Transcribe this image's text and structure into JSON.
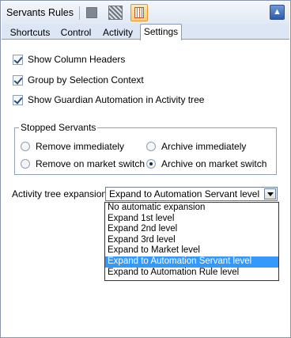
{
  "toolbar": {
    "servants": "Servants",
    "rules": "Rules",
    "icons": [
      "stop-icon",
      "hatch-icon",
      "grid-icon"
    ],
    "pin_icon": "pin-icon"
  },
  "tabs": [
    {
      "label": "Shortcuts",
      "active": false
    },
    {
      "label": "Control",
      "active": false
    },
    {
      "label": "Activity",
      "active": false
    },
    {
      "label": "Settings",
      "active": true
    }
  ],
  "settings": {
    "show_column_headers": {
      "label": "Show Column Headers",
      "checked": true
    },
    "group_by_selection_context": {
      "label": "Group by Selection Context",
      "checked": true
    },
    "show_guardian": {
      "label": "Show Guardian Automation in Activity tree",
      "checked": true
    }
  },
  "stopped_servants": {
    "title": "Stopped Servants",
    "options": [
      {
        "label": "Remove immediately",
        "selected": false
      },
      {
        "label": "Archive immediately",
        "selected": false
      },
      {
        "label": "Remove on market switch",
        "selected": false
      },
      {
        "label": "Archive on market switch",
        "selected": true
      }
    ]
  },
  "activity_tree": {
    "label": "Activity tree expansion",
    "value": "Expand to Automation Servant level",
    "options": [
      "No automatic expansion",
      "Expand 1st level",
      "Expand 2nd level",
      "Expand 3rd level",
      "Expand to Market level",
      "Expand to Automation Servant level",
      "Expand to Automation Rule level"
    ],
    "selected_index": 5
  },
  "colors": {
    "highlight": "#3399ff",
    "tab_bar": "#dce6f4",
    "border": "#8a96a8"
  }
}
